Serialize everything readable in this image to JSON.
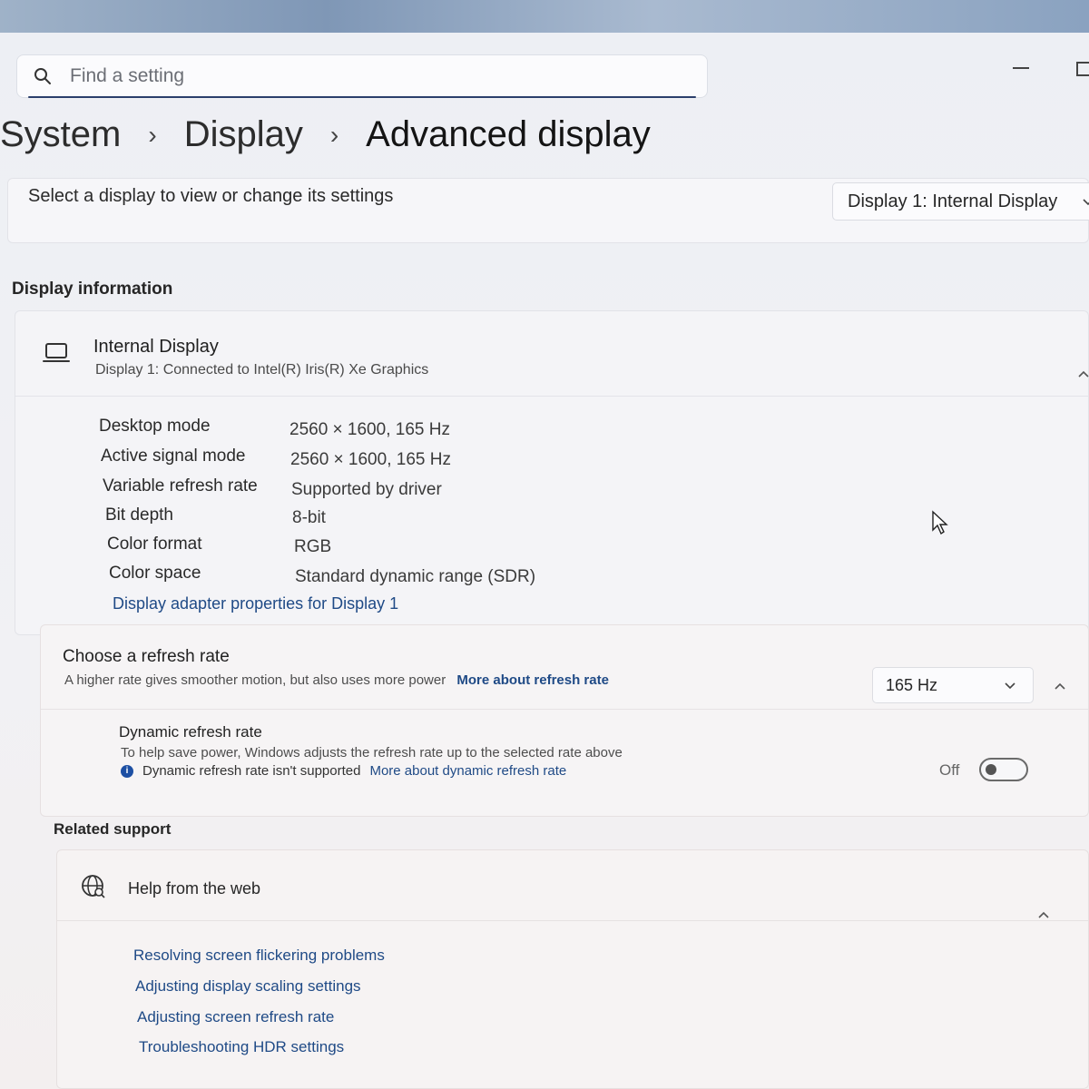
{
  "search": {
    "placeholder": "Find a setting"
  },
  "breadcrumb": [
    "System",
    "Display",
    "Advanced display"
  ],
  "select_display": {
    "label": "Select a display to view or change its settings",
    "selected": "Display 1: Internal Display"
  },
  "display_information": {
    "section_title": "Display information",
    "name": "Internal Display",
    "subtitle": "Display 1: Connected to Intel(R) Iris(R) Xe Graphics",
    "properties": [
      {
        "label": "Desktop mode",
        "value": "2560 × 1600, 165 Hz"
      },
      {
        "label": "Active signal mode",
        "value": "2560 × 1600, 165 Hz"
      },
      {
        "label": "Variable refresh rate",
        "value": "Supported by driver"
      },
      {
        "label": "Bit depth",
        "value": "8-bit"
      },
      {
        "label": "Color format",
        "value": "RGB"
      },
      {
        "label": "Color space",
        "value": "Standard dynamic range (SDR)"
      }
    ],
    "adapter_link": "Display adapter properties for Display 1"
  },
  "refresh_rate": {
    "title": "Choose a refresh rate",
    "description": "A higher rate gives smoother motion, but also uses more power",
    "more_link": "More about refresh rate",
    "selected": "165 Hz",
    "dynamic": {
      "title": "Dynamic refresh rate",
      "description": "To help save power, Windows adjusts the refresh rate up to the selected rate above",
      "warning": "Dynamic refresh rate isn't supported",
      "more_link": "More about dynamic refresh rate",
      "toggle_state": "Off"
    }
  },
  "related_support": {
    "section_title": "Related support",
    "help_title": "Help from the web",
    "links": [
      "Resolving screen flickering problems",
      "Adjusting display scaling settings",
      "Adjusting screen refresh rate",
      "Troubleshooting HDR settings"
    ]
  },
  "colors": {
    "accent": "#1f4a86",
    "info": "#1d4fa3",
    "search_underline": "#2b3f6b"
  }
}
